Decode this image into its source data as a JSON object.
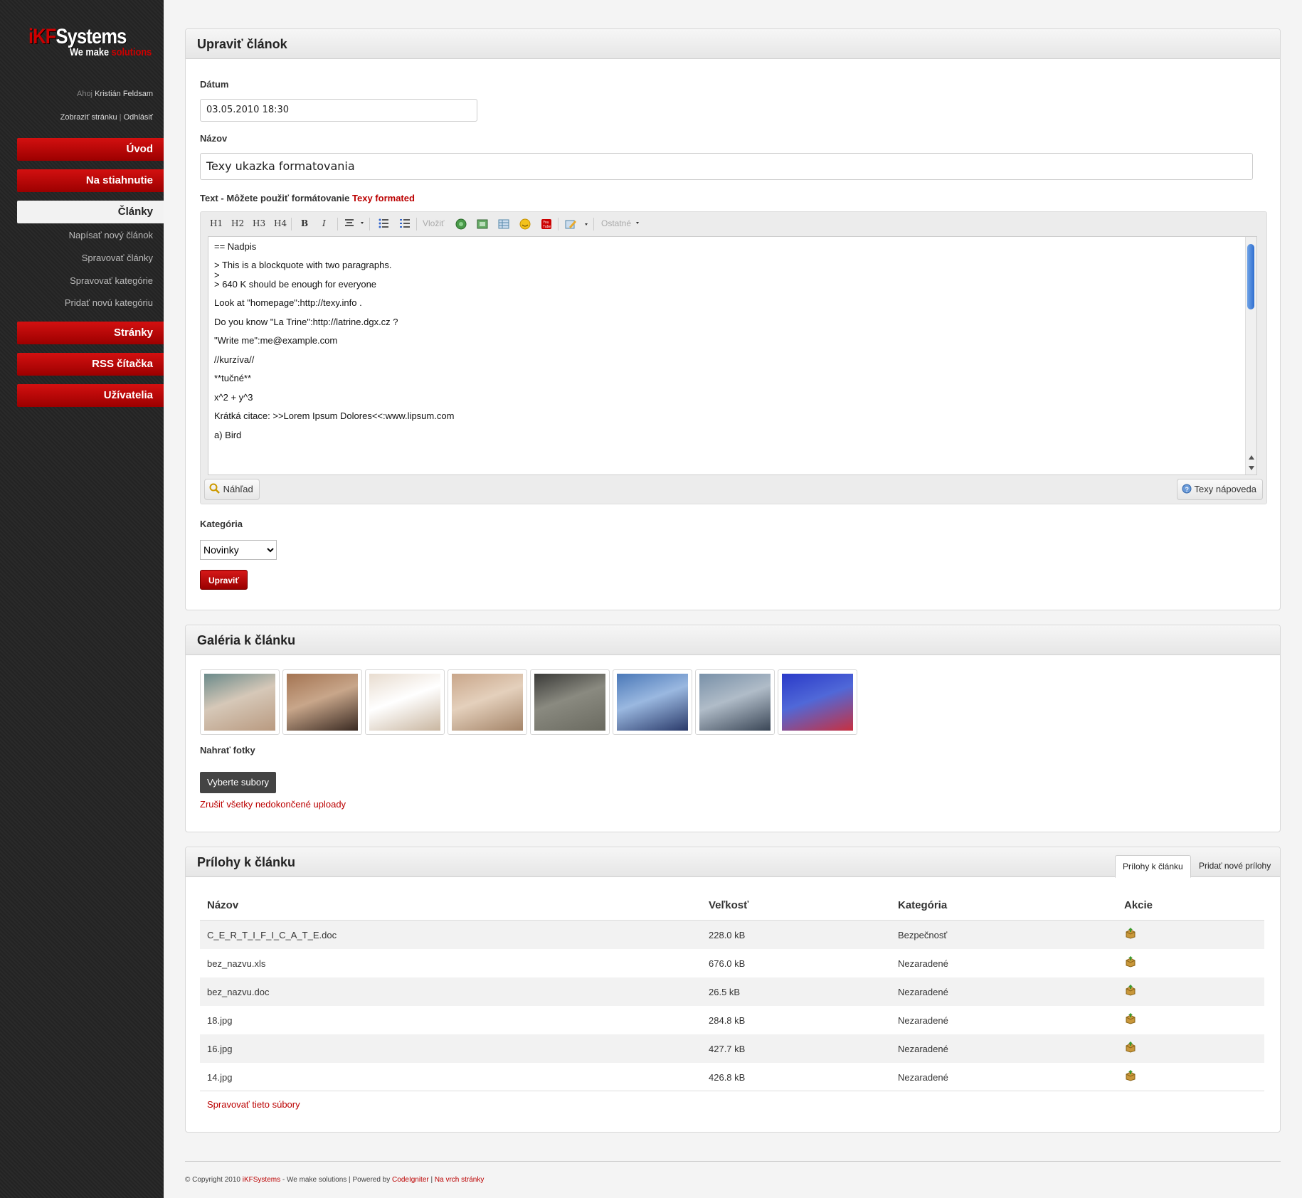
{
  "brand": {
    "logo_part1": "iKF",
    "logo_part2": "Systems",
    "tagline_part1": "We make",
    "tagline_part2": "solutions"
  },
  "user": {
    "greeting": "Ahoj",
    "name": "Kristián Feldsam",
    "view_site": "Zobraziť stránku",
    "separator": "|",
    "logout": "Odhlásiť"
  },
  "nav": {
    "uvod": "Úvod",
    "downloads": "Na stiahnutie",
    "articles": "Články",
    "articles_sub": [
      "Napísať nový článok",
      "Spravovať články",
      "Spravovať kategórie",
      "Pridať novú kategóriu"
    ],
    "pages": "Stránky",
    "rss": "RSS čítačka",
    "users": "Užívatelia"
  },
  "edit": {
    "title": "Upraviť článok",
    "date_label": "Dátum",
    "date_value": "03.05.2010 18:30",
    "name_label": "Názov",
    "name_value": "Texy ukazka formatovania",
    "text_label": "Text - Môžete použiť formátovanie",
    "text_label_link": "Texy formated",
    "toolbar": {
      "h1": "H1",
      "h2": "H2",
      "h3": "H3",
      "h4": "H4",
      "bold": "B",
      "italic": "I",
      "insert": "Vložiť",
      "other": "Ostatné"
    },
    "text_lines": [
      "== Nadpis",
      "> This is a blockquote with two paragraphs.",
      ">",
      "> 640 K should be enough for everyone",
      "Look at \"homepage\":http://texy.info .",
      "Do you know \"La Trine\":http://latrine.dgx.cz ?",
      "\"Write me\":me@example.com",
      "//kurzíva//",
      "**tučné**",
      "x^2 + y^3",
      "Krátká citace: >>Lorem Ipsum Dolores<<:www.lipsum.com",
      "a)  Bird"
    ],
    "preview_button": "Náhľad",
    "help_button": "Texy nápoveda",
    "category_label": "Kategória",
    "category_value": "Novinky",
    "submit_button": "Upraviť"
  },
  "gallery": {
    "title": "Galéria k článku",
    "thumbnails": [
      {
        "colors": [
          "#6a8a8a",
          "#b99a80",
          "#d6c8b8"
        ]
      },
      {
        "colors": [
          "#a47452",
          "#3a2a22",
          "#c8a68a"
        ]
      },
      {
        "colors": [
          "#e8dccf",
          "#c9b6a0",
          "#ffffff"
        ]
      },
      {
        "colors": [
          "#c9a68a",
          "#a48468",
          "#e4d0bc"
        ]
      },
      {
        "colors": [
          "#3a3a38",
          "#6a6a60",
          "#8a8a80"
        ]
      },
      {
        "colors": [
          "#4a78b8",
          "#2a3a6a",
          "#9ab8e0"
        ]
      },
      {
        "colors": [
          "#7890a8",
          "#3a4656",
          "#b0bcc8"
        ]
      },
      {
        "colors": [
          "#2a3ac8",
          "#c83040",
          "#5068d8"
        ]
      }
    ],
    "upload_label": "Nahrať fotky",
    "select_files": "Vyberte subory",
    "cancel_uploads": "Zrušiť všetky nedokončené uploady"
  },
  "attachments": {
    "title": "Prílohy k článku",
    "tabs": [
      "Prílohy k článku",
      "Pridať nové prílohy"
    ],
    "columns": [
      "Názov",
      "Veľkosť",
      "Kategória",
      "Akcie"
    ],
    "rows": [
      {
        "name": "C_E_R_T_I_F_I_C_A_T_E.doc",
        "size": "228.0 kB",
        "category": "Bezpečnosť"
      },
      {
        "name": "bez_nazvu.xls",
        "size": "676.0 kB",
        "category": "Nezaradené"
      },
      {
        "name": "bez_nazvu.doc",
        "size": "26.5 kB",
        "category": "Nezaradené"
      },
      {
        "name": "18.jpg",
        "size": "284.8 kB",
        "category": "Nezaradené"
      },
      {
        "name": "16.jpg",
        "size": "427.7 kB",
        "category": "Nezaradené"
      },
      {
        "name": "14.jpg",
        "size": "426.8 kB",
        "category": "Nezaradené"
      }
    ],
    "manage_link": "Spravovať tieto súbory"
  },
  "footer": {
    "copy": "© Copyright 2010",
    "brand": "iKFSystems",
    "tagline": "- We make solutions |",
    "powered": "Powered by",
    "ci": "CodeIgniter",
    "sep": "|",
    "top": "Na vrch stránky"
  },
  "colors": {
    "accent": "#c00000",
    "sidebar": "#262626"
  }
}
